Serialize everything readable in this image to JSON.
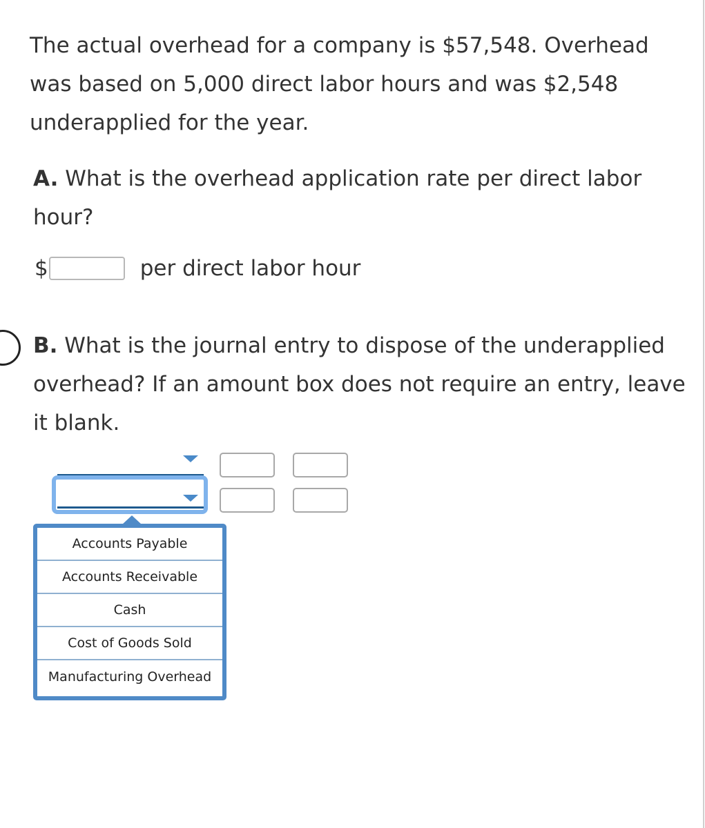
{
  "intro": {
    "text": "The actual overhead for a company is $57,548. Overhead was based on 5,000 direct labor hours and was $2,548 underapplied for the year."
  },
  "question_a": {
    "label": "A.",
    "text": " What is the overhead application rate per direct labor hour?",
    "currency_symbol": "$",
    "input_value": "",
    "unit_text": "per direct labor hour"
  },
  "question_b": {
    "label": "B.",
    "text": " What is the journal entry to dispose of the underapplied overhead? If an amount box does not require an entry, leave it blank.",
    "journal_rows": [
      {
        "account": "",
        "debit": "",
        "credit": ""
      },
      {
        "account": "",
        "debit": "",
        "credit": ""
      }
    ],
    "dropdown_open_for_row": 2,
    "dropdown_options": [
      "Accounts Payable",
      "Accounts Receivable",
      "Cash",
      "Cost of Goods Sold",
      "Manufacturing Overhead"
    ]
  },
  "colors": {
    "focus_ring": "#7fb3ec",
    "dropdown_border": "#4f8ac7",
    "caret": "#4a8ac9",
    "select_underline": "#1e5a8e"
  }
}
